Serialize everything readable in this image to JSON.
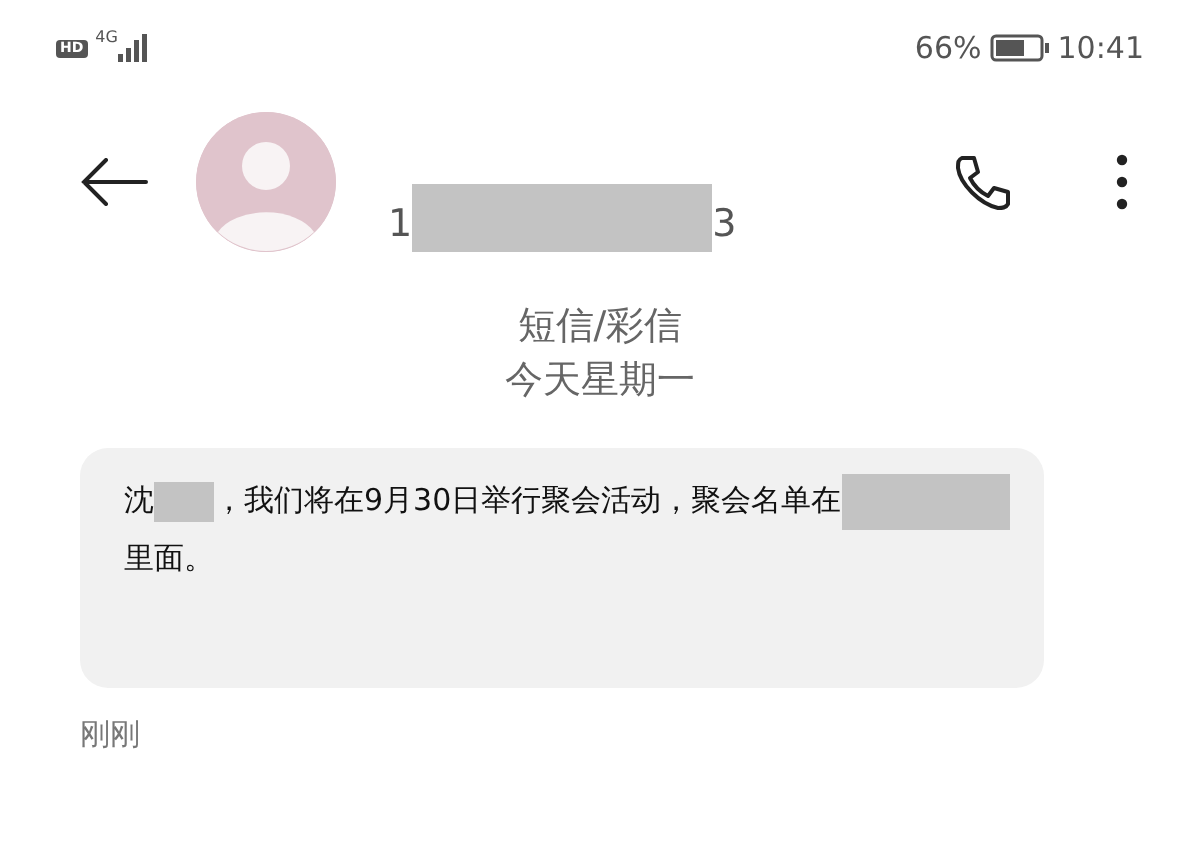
{
  "status_bar": {
    "hd_badge": "HD",
    "network": "4G",
    "battery": "66%",
    "time": "10:41"
  },
  "header": {
    "number_parts": [
      {
        "kind": "text",
        "text": "1"
      },
      {
        "kind": "redaction"
      },
      {
        "kind": "text",
        "text": "3"
      }
    ]
  },
  "thread_info": {
    "channel": "短信/彩信",
    "date": "今天星期一"
  },
  "messages": [
    {
      "parts": [
        {
          "kind": "text",
          "text": "沈"
        },
        {
          "kind": "short_redaction"
        },
        {
          "kind": "text",
          "text": "，我们将在9月30日举行聚会活动，聚会名单在"
        },
        {
          "kind": "long_redaction"
        },
        {
          "kind": "text",
          "text": "里面。"
        }
      ],
      "time": "刚刚"
    }
  ]
}
